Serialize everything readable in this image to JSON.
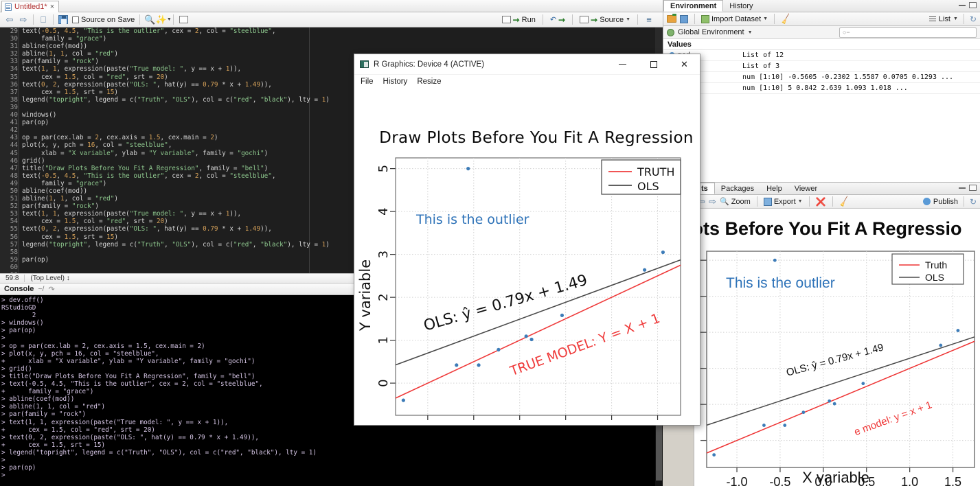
{
  "editor": {
    "tab_label": "Untitled1*",
    "tab_close": "×",
    "toolbar": {
      "source_on_save": "Source on Save",
      "run_label": "Run",
      "source_label": "Source"
    },
    "status": {
      "position": "59:8",
      "scope": "(Top Level)",
      "scope_caret": "↕"
    },
    "code_lines": [
      {
        "n": "29",
        "text": "text(-0.5, 4.5, \"This is the outlier\", cex = 2, col = \"steelblue\","
      },
      {
        "n": "30",
        "text": "     family = \"grace\")"
      },
      {
        "n": "31",
        "text": "abline(coef(mod))"
      },
      {
        "n": "32",
        "text": "abline(1, 1, col = \"red\")"
      },
      {
        "n": "33",
        "text": "par(family = \"rock\")"
      },
      {
        "n": "34",
        "text": "text(1, 1, expression(paste(\"True model: \", y == x + 1)),"
      },
      {
        "n": "35",
        "text": "     cex = 1.5, col = \"red\", srt = 20)"
      },
      {
        "n": "36",
        "text": "text(0, 2, expression(paste(\"OLS: \", hat(y) == 0.79 * x + 1.49)),"
      },
      {
        "n": "37",
        "text": "     cex = 1.5, srt = 15)"
      },
      {
        "n": "38",
        "text": "legend(\"topright\", legend = c(\"Truth\", \"OLS\"), col = c(\"red\", \"black\"), lty = 1)"
      },
      {
        "n": "39",
        "text": ""
      },
      {
        "n": "40",
        "text": "windows()"
      },
      {
        "n": "41",
        "text": "par(op)"
      },
      {
        "n": "42",
        "text": ""
      },
      {
        "n": "43",
        "text": "op = par(cex.lab = 2, cex.axis = 1.5, cex.main = 2)"
      },
      {
        "n": "44",
        "text": "plot(x, y, pch = 16, col = \"steelblue\","
      },
      {
        "n": "45",
        "text": "     xlab = \"X variable\", ylab = \"Y variable\", family = \"gochi\")"
      },
      {
        "n": "46",
        "text": "grid()"
      },
      {
        "n": "47",
        "text": "title(\"Draw Plots Before You Fit A Regression\", family = \"bell\")"
      },
      {
        "n": "48",
        "text": "text(-0.5, 4.5, \"This is the outlier\", cex = 2, col = \"steelblue\","
      },
      {
        "n": "49",
        "text": "     family = \"grace\")"
      },
      {
        "n": "50",
        "text": "abline(coef(mod))"
      },
      {
        "n": "51",
        "text": "abline(1, 1, col = \"red\")"
      },
      {
        "n": "52",
        "text": "par(family = \"rock\")"
      },
      {
        "n": "53",
        "text": "text(1, 1, expression(paste(\"True model: \", y == x + 1)),"
      },
      {
        "n": "54",
        "text": "     cex = 1.5, col = \"red\", srt = 20)"
      },
      {
        "n": "55",
        "text": "text(0, 2, expression(paste(\"OLS: \", hat(y) == 0.79 * x + 1.49)),"
      },
      {
        "n": "56",
        "text": "     cex = 1.5, srt = 15)"
      },
      {
        "n": "57",
        "text": "legend(\"topright\", legend = c(\"Truth\", \"OLS\"), col = c(\"red\", \"black\"), lty = 1)"
      },
      {
        "n": "58",
        "text": ""
      },
      {
        "n": "59",
        "text": "par(op)"
      },
      {
        "n": "60",
        "text": ""
      },
      {
        "n": "61",
        "text": ""
      }
    ]
  },
  "console": {
    "title": "Console",
    "path": "~/",
    "lines": [
      "> dev.off()",
      "RStudioGD",
      "        2",
      "> windows()",
      "> par(op)",
      ">",
      "> op = par(cex.lab = 2, cex.axis = 1.5, cex.main = 2)",
      "> plot(x, y, pch = 16, col = \"steelblue\",",
      "+      xlab = \"X variable\", ylab = \"Y variable\", family = \"gochi\")",
      "> grid()",
      "> title(\"Draw Plots Before You Fit A Regression\", family = \"bell\")",
      "> text(-0.5, 4.5, \"This is the outlier\", cex = 2, col = \"steelblue\",",
      "+      family = \"grace\")",
      "> abline(coef(mod))",
      "> abline(1, 1, col = \"red\")",
      "> par(family = \"rock\")",
      "> text(1, 1, expression(paste(\"True model: \", y == x + 1)),",
      "+      cex = 1.5, col = \"red\", srt = 20)",
      "> text(0, 2, expression(paste(\"OLS: \", hat(y) == 0.79 * x + 1.49)),",
      "+      cex = 1.5, srt = 15)",
      "> legend(\"topright\", legend = c(\"Truth\", \"OLS\"), col = c(\"red\", \"black\"), lty = 1)",
      ">",
      "> par(op)",
      ">"
    ]
  },
  "environment": {
    "tabs": [
      "Environment",
      "History"
    ],
    "active_tab": "Environment",
    "toolbar": {
      "import_dataset": "Import Dataset",
      "list_label": "List"
    },
    "scope": "Global Environment",
    "search_placeholder": "",
    "section_label": "Values",
    "rows": [
      {
        "name": "mod",
        "value": "List of 12"
      },
      {
        "name": "",
        "value": "List of 3"
      },
      {
        "name": "",
        "value": "num [1:10] -0.5605 -0.2302 1.5587 0.0705 0.1293 ..."
      },
      {
        "name": "",
        "value": "num [1:10] 5 0.842 2.639 1.093 1.018 ..."
      }
    ]
  },
  "plots_pane": {
    "tabs": [
      "ts",
      "Packages",
      "Help",
      "Viewer"
    ],
    "active_tab": "ts",
    "toolbar": {
      "zoom": "Zoom",
      "export": "Export",
      "publish": "Publish"
    },
    "plot_title": "w Plots Before You Fit A Regressio",
    "outlier_label": "This is the outlier",
    "ols_label": "OLS: ŷ = 0.79x + 1.49",
    "truth_label": "e model: y = x + 1",
    "legend": [
      "Truth",
      "OLS"
    ],
    "xlabel": "X variable",
    "xticks": [
      "-1.0",
      "-0.5",
      "0.0",
      "0.5",
      "1.0",
      "1.5"
    ]
  },
  "rgraphics_window": {
    "title": "R Graphics: Device 4 (ACTIVE)",
    "menu": [
      "File",
      "History",
      "Resize"
    ],
    "window_buttons": {
      "minimize": "–",
      "maximize": "□",
      "close": "✕"
    }
  },
  "chart_data": {
    "type": "scatter",
    "title": "Draw Plots Before You Fit A Regression",
    "xlabel": "X variable",
    "ylabel": "Y variable",
    "xlim": [
      -1.35,
      1.75
    ],
    "ylim": [
      -0.75,
      5.25
    ],
    "xticks": [
      -1.0,
      -0.5,
      0.0,
      0.5,
      1.0,
      1.5
    ],
    "yticks": [
      0,
      1,
      2,
      3,
      4,
      5
    ],
    "grid": true,
    "point_color": "#3d7cb8",
    "points": [
      {
        "x": -0.5605,
        "y": 5.0
      },
      {
        "x": -1.2651,
        "y": -0.4
      },
      {
        "x": -0.6869,
        "y": 0.42
      },
      {
        "x": -0.4457,
        "y": 0.42
      },
      {
        "x": -0.2302,
        "y": 0.78
      },
      {
        "x": 0.0705,
        "y": 1.093
      },
      {
        "x": 0.1293,
        "y": 1.018
      },
      {
        "x": 0.4609,
        "y": 1.58
      },
      {
        "x": 1.3587,
        "y": 2.639
      },
      {
        "x": 1.5587,
        "y": 3.05
      }
    ],
    "lines": [
      {
        "name": "OLS",
        "color": "#4a4a4a",
        "intercept": 1.49,
        "slope": 0.79
      },
      {
        "name": "Truth",
        "color": "#ee3333",
        "intercept": 1.0,
        "slope": 1.0
      }
    ],
    "annotations": [
      {
        "text": "This is the outlier",
        "x": -0.5,
        "y": 4.5,
        "color": "#3d7cb8"
      },
      {
        "text": "OLS: ŷ = 0.79x + 1.49",
        "x": 0.0,
        "y": 2.0,
        "color": "#000000",
        "rotation": -15
      },
      {
        "text": "True model: y = x + 1",
        "x": 1.0,
        "y": 1.0,
        "color": "#ee3333",
        "rotation": -20
      }
    ],
    "legend": {
      "position": "topright",
      "entries": [
        {
          "label": "Truth",
          "color": "#ee3333"
        },
        {
          "label": "OLS",
          "color": "#4a4a4a"
        }
      ]
    }
  }
}
